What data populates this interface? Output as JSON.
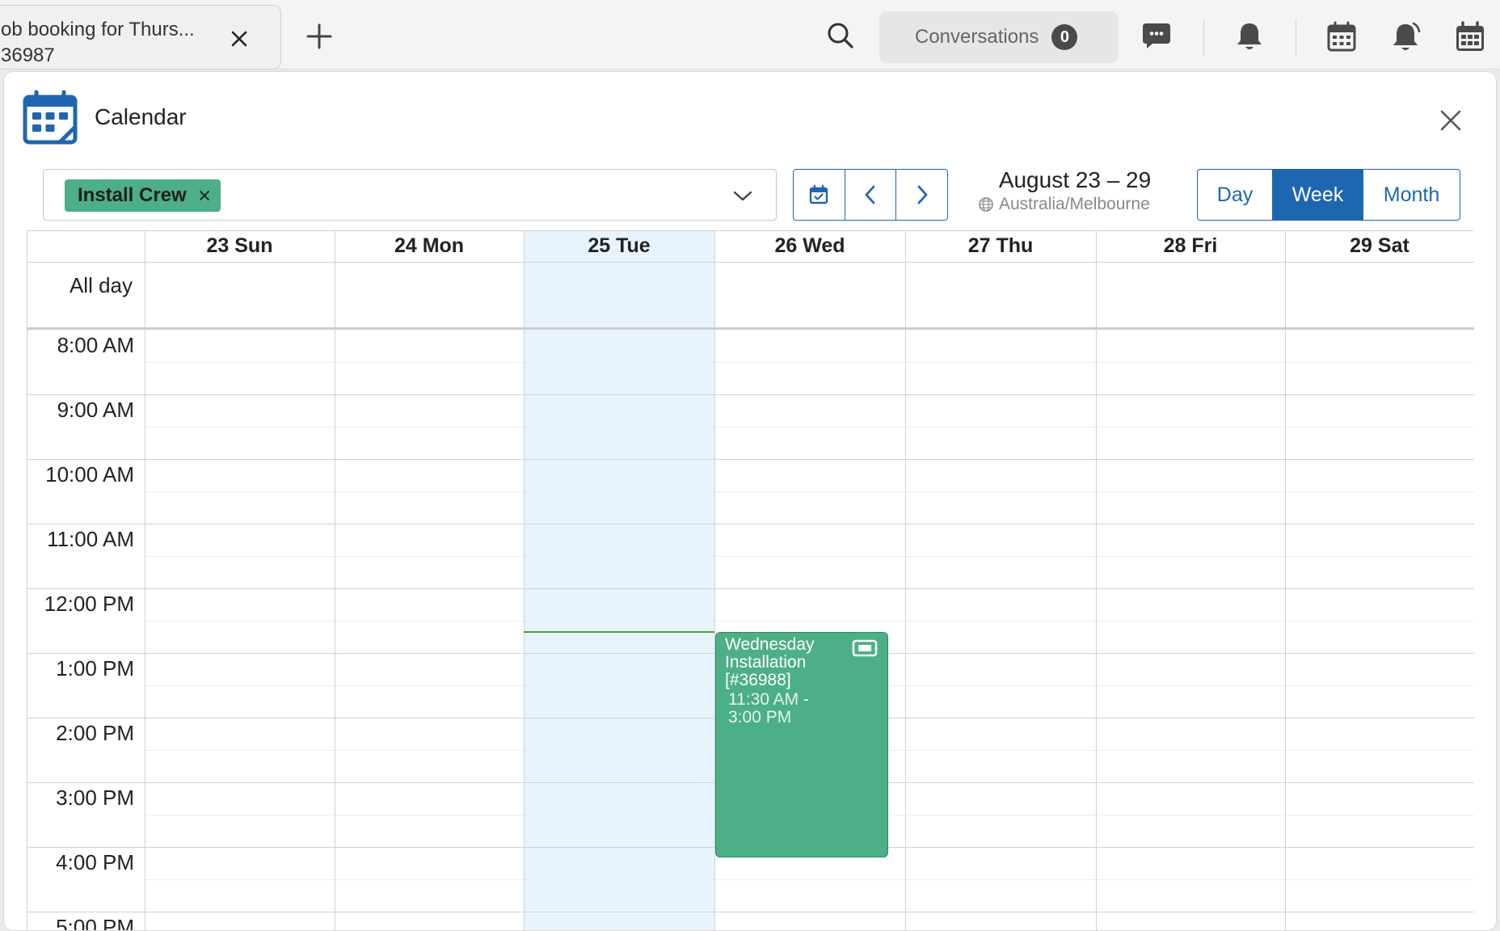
{
  "topbar": {
    "tab": {
      "title": "ob booking for Thurs...",
      "subtitle": "36987"
    },
    "conversations": {
      "label": "Conversations",
      "count": "0"
    }
  },
  "calendar": {
    "title": "Calendar",
    "filter": {
      "chip_label": "Install Crew"
    },
    "range_title": "August 23 – 29",
    "timezone": "Australia/Melbourne",
    "views": {
      "day": "Day",
      "week": "Week",
      "month": "Month",
      "active": "Week"
    },
    "days": [
      {
        "label": "23 Sun",
        "today": false
      },
      {
        "label": "24 Mon",
        "today": false
      },
      {
        "label": "25 Tue",
        "today": true
      },
      {
        "label": "26 Wed",
        "today": false
      },
      {
        "label": "27 Thu",
        "today": false
      },
      {
        "label": "28 Fri",
        "today": false
      },
      {
        "label": "29 Sat",
        "today": false
      }
    ],
    "all_day_label": "All day",
    "times": [
      "8:00 AM",
      "9:00 AM",
      "10:00 AM",
      "11:00 AM",
      "12:00 PM",
      "1:00 PM",
      "2:00 PM",
      "3:00 PM",
      "4:00 PM",
      "5:00 PM"
    ],
    "event": {
      "title": "Wednesday Installation [#36988]",
      "time": "11:30 AM - 3:00 PM",
      "day": "26 Wed",
      "color": "#4caf87"
    }
  },
  "colors": {
    "accent": "#1f66b0",
    "today_column": "#e8f4fd",
    "chip": "#4caf87",
    "now_line": "#5aa02c"
  },
  "icons": {
    "search": "search-icon",
    "chat": "chat-bubble-icon",
    "bell": "bell-icon",
    "calendar": "calendar-icon",
    "bell_alt": "bell-ring-icon",
    "calendar_active": "calendar-active-icon"
  }
}
